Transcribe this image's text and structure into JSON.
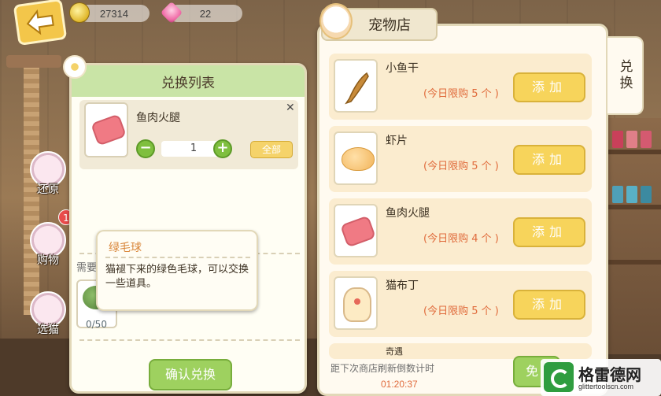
{
  "resources": {
    "coins": "27314",
    "gems": "22"
  },
  "exchange_panel": {
    "title": "兑换列表",
    "item_name": "鱼肉火腿",
    "quantity": "1",
    "all_label": "全部",
    "need_label": "需要",
    "need_count": "0/50",
    "confirm_label": "确认兑换"
  },
  "tooltip": {
    "title": "绿毛球",
    "description": "猫褪下来的绿色毛球，可以交换一些道具。"
  },
  "side_buttons": [
    {
      "label": "还原"
    },
    {
      "label": "购物",
      "badge": "1"
    },
    {
      "label": "选猫"
    }
  ],
  "shop": {
    "title": "宠物店",
    "tab_label": "兑换",
    "items": [
      {
        "name": "小鱼干",
        "limit": "(今日限购 5 个 )",
        "button": "添加"
      },
      {
        "name": "虾片",
        "limit": "(今日限购 5 个 )",
        "button": "添加"
      },
      {
        "name": "鱼肉火腿",
        "limit": "(今日限购 4 个 )",
        "button": "添加"
      },
      {
        "name": "猫布丁",
        "limit": "(今日限购 5 个 )",
        "button": "添加"
      },
      {
        "name": "奇遇",
        "limit": "",
        "button": ""
      }
    ],
    "refresh_label": "距下次商店刷新倒数计时",
    "refresh_time": "01:20:37",
    "free_label": "免"
  },
  "watermark": {
    "title": "格雷德网",
    "url": "glittertoolscn.com"
  },
  "colors": {
    "header_green": "#c9e4a6",
    "button_yellow": "#f7d45b",
    "button_green": "#9ed15f",
    "limit_orange": "#e06b3c"
  }
}
